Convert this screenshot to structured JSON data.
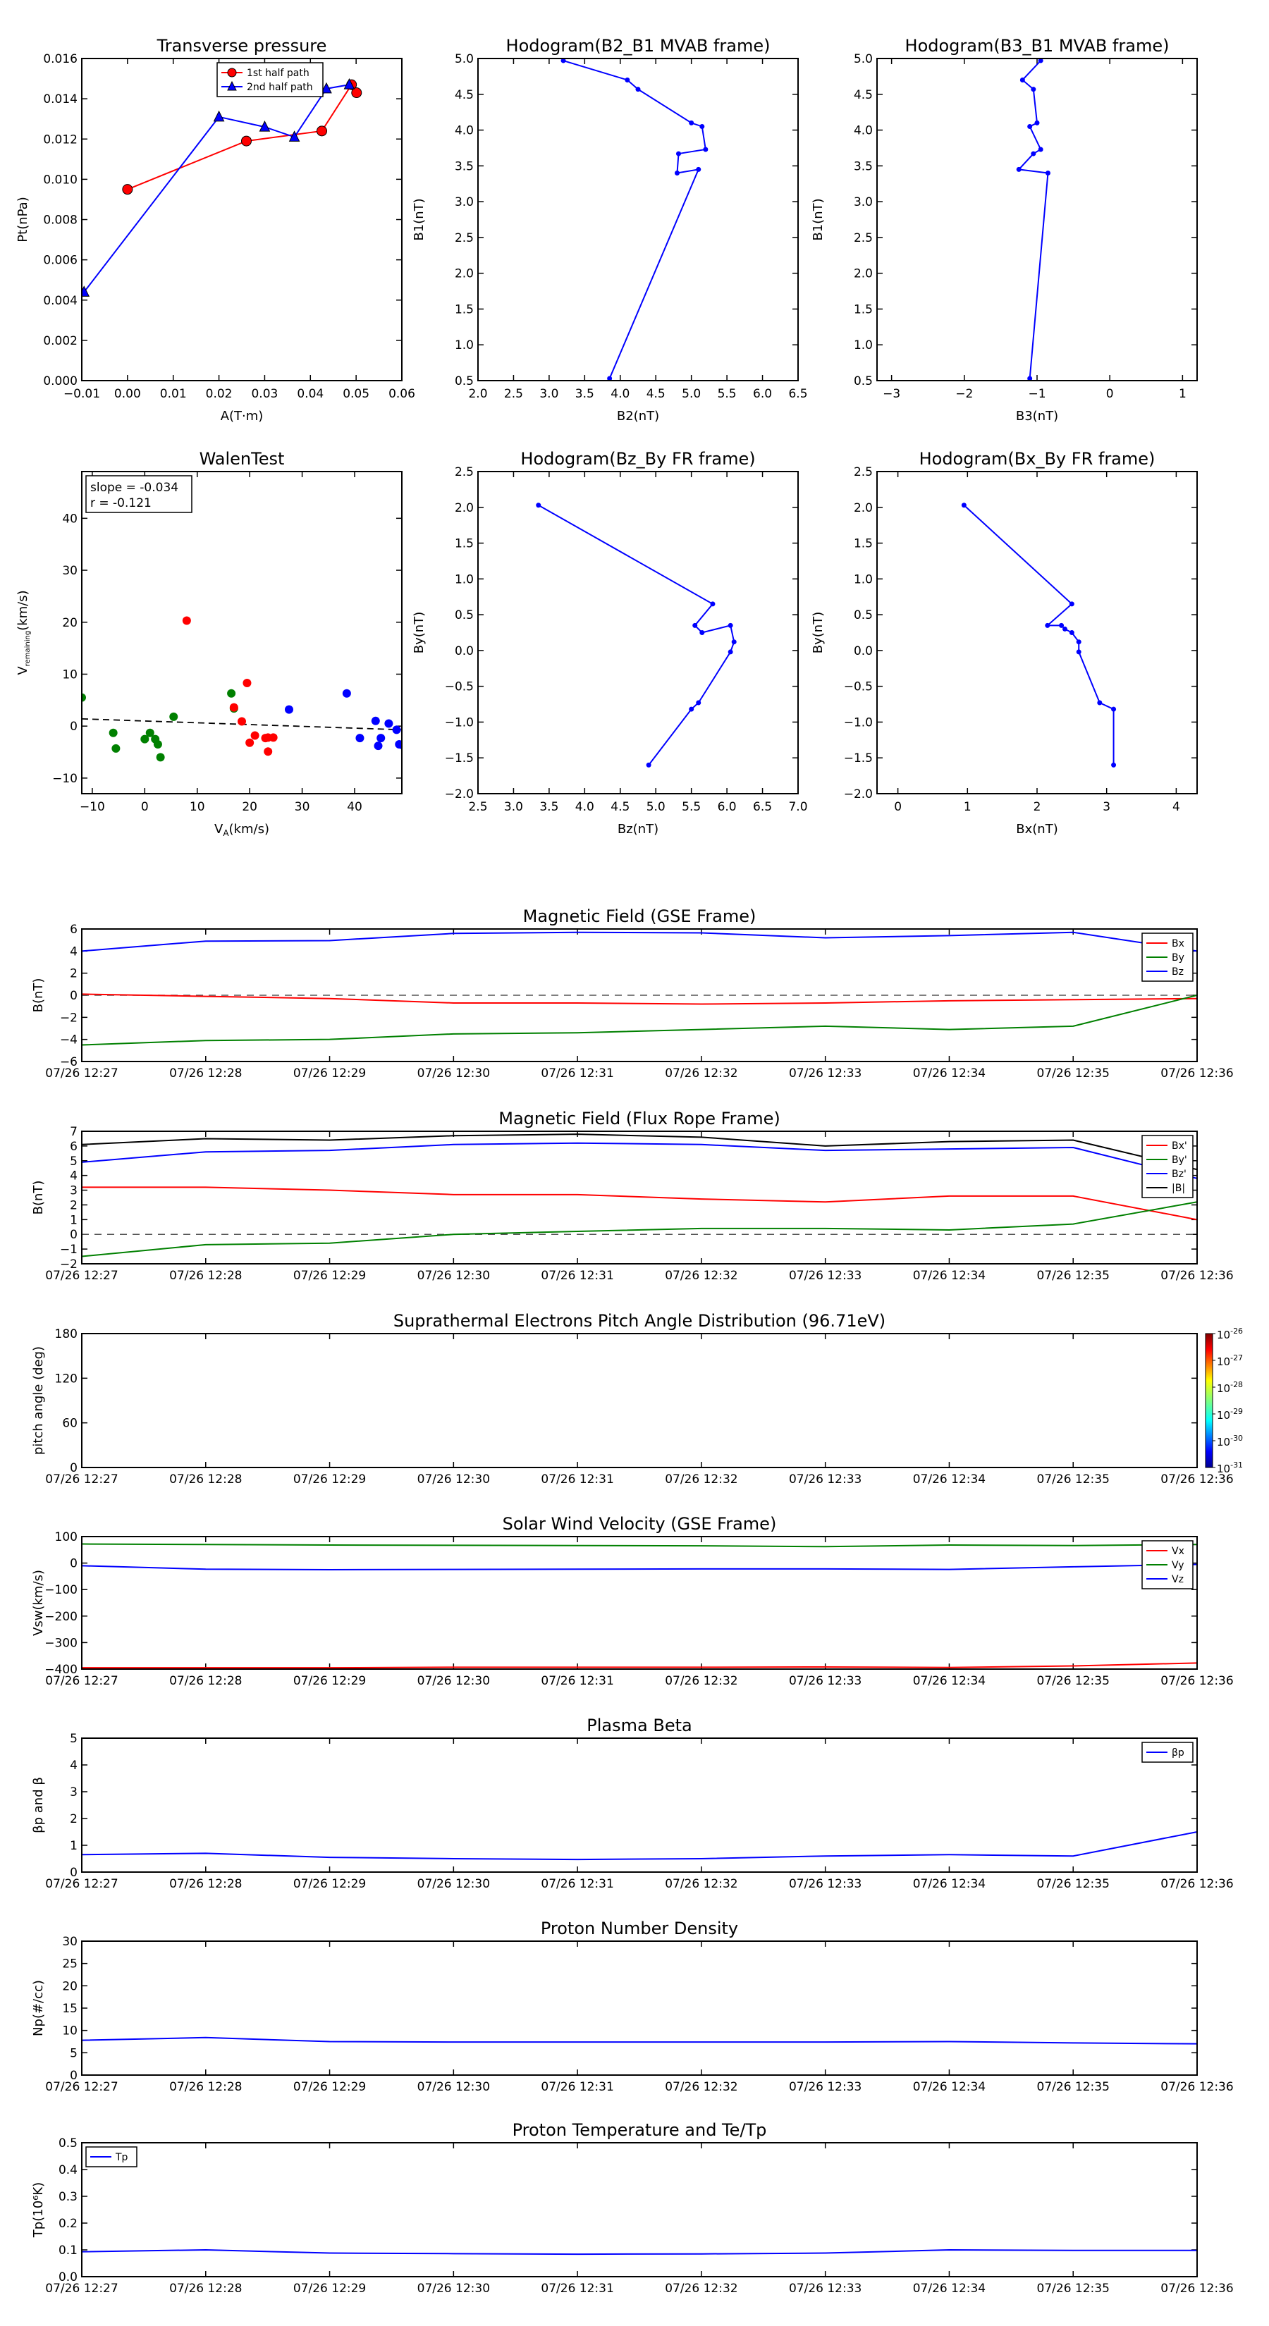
{
  "figure": {
    "time_ticks": [
      "07/26 12:27",
      "07/26 12:28",
      "07/26 12:29",
      "07/26 12:30",
      "07/26 12:31",
      "07/26 12:32",
      "07/26 12:33",
      "07/26 12:34",
      "07/26 12:35",
      "07/26 12:36"
    ]
  },
  "chart_data": [
    {
      "type": "line",
      "id": "tp",
      "title": "Transverse pressure",
      "xlabel": "A(T·m)",
      "ylabel": "Pt(nPa)",
      "xlim": [
        -0.01,
        0.06
      ],
      "ylim": [
        0,
        0.016
      ],
      "xticks": [
        -0.01,
        0.0,
        0.01,
        0.02,
        0.03,
        0.04,
        0.05,
        0.06
      ],
      "xticklabels": [
        "−0.01",
        "0.00",
        "0.01",
        "0.02",
        "0.03",
        "0.04",
        "0.05",
        "0.06"
      ],
      "yticks": [
        0,
        0.002,
        0.004,
        0.006,
        0.008,
        0.01,
        0.012,
        0.014,
        0.016
      ],
      "yticklabels": [
        "0.000",
        "0.002",
        "0.004",
        "0.006",
        "0.008",
        "0.010",
        "0.012",
        "0.014",
        "0.016"
      ],
      "legend": "top-center",
      "series": [
        {
          "name": "1st half path",
          "color": "#ff0000",
          "marker": "circle",
          "x": [
            0.0,
            0.026,
            0.0425,
            0.049,
            0.0501
          ],
          "y": [
            0.0095,
            0.0119,
            0.0124,
            0.0147,
            0.0143
          ]
        },
        {
          "name": "2nd half path",
          "color": "#0000ff",
          "marker": "triangle",
          "x": [
            -0.0095,
            0.02,
            0.03,
            0.0365,
            0.0435,
            0.0485
          ],
          "y": [
            0.0044,
            0.0131,
            0.0126,
            0.0121,
            0.0145,
            0.0147
          ]
        }
      ]
    },
    {
      "type": "line",
      "id": "h1",
      "title": "Hodogram(B2_B1 MVAB frame)",
      "xlabel": "B2(nT)",
      "ylabel": "B1(nT)",
      "xlim": [
        2.0,
        6.5
      ],
      "ylim": [
        0.5,
        5.0
      ],
      "xticks": [
        2.0,
        2.5,
        3.0,
        3.5,
        4.0,
        4.5,
        5.0,
        5.5,
        6.0,
        6.5
      ],
      "xticklabels": [
        "2.0",
        "2.5",
        "3.0",
        "3.5",
        "4.0",
        "4.5",
        "5.0",
        "5.5",
        "6.0",
        "6.5"
      ],
      "yticks": [
        0.5,
        1.0,
        1.5,
        2.0,
        2.5,
        3.0,
        3.5,
        4.0,
        4.5,
        5.0
      ],
      "yticklabels": [
        "0.5",
        "1.0",
        "1.5",
        "2.0",
        "2.5",
        "3.0",
        "3.5",
        "4.0",
        "4.5",
        "5.0"
      ],
      "series": [
        {
          "color": "#0000ff",
          "marker": "dot",
          "x": [
            3.2,
            4.1,
            4.25,
            5.0,
            5.15,
            5.2,
            4.82,
            4.8,
            5.1,
            3.85
          ],
          "y": [
            4.97,
            4.7,
            4.57,
            4.1,
            4.05,
            3.73,
            3.67,
            3.4,
            3.45,
            0.53
          ]
        }
      ]
    },
    {
      "type": "line",
      "id": "h2",
      "title": "Hodogram(B3_B1 MVAB frame)",
      "xlabel": "B3(nT)",
      "ylabel": "B1(nT)",
      "xlim": [
        -3.2,
        1.2
      ],
      "ylim": [
        0.5,
        5.0
      ],
      "xticks": [
        -3,
        -2,
        -1,
        0,
        1
      ],
      "xticklabels": [
        "−3",
        "−2",
        "−1",
        "0",
        "1"
      ],
      "yticks": [
        0.5,
        1.0,
        1.5,
        2.0,
        2.5,
        3.0,
        3.5,
        4.0,
        4.5,
        5.0
      ],
      "yticklabels": [
        "0.5",
        "1.0",
        "1.5",
        "2.0",
        "2.5",
        "3.0",
        "3.5",
        "4.0",
        "4.5",
        "5.0"
      ],
      "series": [
        {
          "color": "#0000ff",
          "marker": "dot",
          "x": [
            -0.95,
            -1.2,
            -1.05,
            -1.0,
            -1.1,
            -0.95,
            -1.05,
            -1.25,
            -0.85,
            -1.1
          ],
          "y": [
            4.97,
            4.7,
            4.57,
            4.1,
            4.05,
            3.73,
            3.67,
            3.45,
            3.4,
            0.53
          ]
        }
      ]
    },
    {
      "type": "scatter",
      "id": "walen",
      "title": "WalenTest",
      "xlabel": "V_A(km/s)",
      "ylabel": "V_remaining(km/s)",
      "xlim": [
        -12,
        49
      ],
      "ylim": [
        -13,
        49
      ],
      "xticks": [
        -10,
        0,
        10,
        20,
        30,
        40
      ],
      "xticklabels": [
        "−10",
        "0",
        "10",
        "20",
        "30",
        "40"
      ],
      "yticks": [
        -10,
        0,
        10,
        20,
        30,
        40
      ],
      "yticklabels": [
        "−10",
        "0",
        "10",
        "20",
        "30",
        "40"
      ],
      "annotation": [
        "slope = -0.034",
        "r = -0.121"
      ],
      "fit_line": {
        "x": [
          -12,
          49
        ],
        "y": [
          1.4,
          -0.7
        ]
      },
      "series": [
        {
          "color": "#008000",
          "x": [
            -12,
            -6,
            -5.5,
            0,
            1,
            2,
            2.5,
            3,
            5.5,
            16.5,
            17
          ],
          "y": [
            5.5,
            -1.3,
            -4.3,
            -2.5,
            -1.3,
            -2.5,
            -3.5,
            -6,
            1.8,
            6.3,
            3.4
          ]
        },
        {
          "color": "#ff0000",
          "x": [
            8,
            17,
            18.5,
            19.5,
            20,
            21,
            23,
            23.5,
            23.5,
            24.5
          ],
          "y": [
            20.3,
            3.6,
            0.9,
            8.3,
            -3.2,
            -1.8,
            -2.3,
            -2.2,
            -4.9,
            -2.2
          ]
        },
        {
          "color": "#0000ff",
          "x": [
            27.5,
            38.5,
            41,
            44,
            44.5,
            45,
            46.5,
            48,
            48.5,
            49
          ],
          "y": [
            3.2,
            6.3,
            -2.3,
            1.0,
            -3.8,
            -2.3,
            0.5,
            -0.7,
            -3.5,
            -3.6
          ]
        }
      ]
    },
    {
      "type": "line",
      "id": "h3",
      "title": "Hodogram(Bz_By FR frame)",
      "xlabel": "Bz(nT)",
      "ylabel": "By(nT)",
      "xlim": [
        2.5,
        7.0
      ],
      "ylim": [
        -2.0,
        2.5
      ],
      "xticks": [
        2.5,
        3.0,
        3.5,
        4.0,
        4.5,
        5.0,
        5.5,
        6.0,
        6.5,
        7.0
      ],
      "xticklabels": [
        "2.5",
        "3.0",
        "3.5",
        "4.0",
        "4.5",
        "5.0",
        "5.5",
        "6.0",
        "6.5",
        "7.0"
      ],
      "yticks": [
        -2.0,
        -1.5,
        -1.0,
        -0.5,
        0.0,
        0.5,
        1.0,
        1.5,
        2.0,
        2.5
      ],
      "yticklabels": [
        "−2.0",
        "−1.5",
        "−1.0",
        "−0.5",
        "0.0",
        "0.5",
        "1.0",
        "1.5",
        "2.0",
        "2.5"
      ],
      "series": [
        {
          "color": "#0000ff",
          "marker": "dot",
          "x": [
            3.35,
            5.8,
            5.55,
            5.65,
            6.05,
            6.1,
            6.05,
            5.6,
            5.5,
            4.9
          ],
          "y": [
            2.03,
            0.65,
            0.35,
            0.25,
            0.35,
            0.12,
            -0.02,
            -0.73,
            -0.82,
            -1.6
          ]
        }
      ]
    },
    {
      "type": "line",
      "id": "h4",
      "title": "Hodogram(Bx_By FR frame)",
      "xlabel": "Bx(nT)",
      "ylabel": "By(nT)",
      "xlim": [
        -0.3,
        4.3
      ],
      "ylim": [
        -2.0,
        2.5
      ],
      "xticks": [
        0,
        1,
        2,
        3,
        4
      ],
      "xticklabels": [
        "0",
        "1",
        "2",
        "3",
        "4"
      ],
      "yticks": [
        -2.0,
        -1.5,
        -1.0,
        -0.5,
        0.0,
        0.5,
        1.0,
        1.5,
        2.0,
        2.5
      ],
      "yticklabels": [
        "−2.0",
        "−1.5",
        "−1.0",
        "−0.5",
        "0.0",
        "0.5",
        "1.0",
        "1.5",
        "2.0",
        "2.5"
      ],
      "series": [
        {
          "color": "#0000ff",
          "marker": "dot",
          "x": [
            0.95,
            2.5,
            2.15,
            2.35,
            2.4,
            2.5,
            2.6,
            2.6,
            2.9,
            3.1,
            3.1
          ],
          "y": [
            2.03,
            0.65,
            0.35,
            0.35,
            0.3,
            0.25,
            0.12,
            -0.02,
            -0.73,
            -0.82,
            -1.6
          ]
        }
      ]
    },
    {
      "type": "line",
      "id": "mf_gse",
      "title": "Magnetic Field (GSE Frame)",
      "ylabel": "B(nT)",
      "xlim": [
        0,
        9
      ],
      "ylim": [
        -6,
        6
      ],
      "yticks": [
        -6,
        -4,
        -2,
        0,
        2,
        4,
        6
      ],
      "yticklabels": [
        "−6",
        "−4",
        "−2",
        "0",
        "2",
        "4",
        "6"
      ],
      "zero_line": true,
      "legend": "top-right",
      "series": [
        {
          "name": "Bx",
          "color": "#ff0000",
          "y": [
            0.1,
            -0.1,
            -0.3,
            -0.7,
            -0.7,
            -0.8,
            -0.7,
            -0.5,
            -0.4,
            -0.3
          ]
        },
        {
          "name": "By",
          "color": "#008000",
          "y": [
            -4.5,
            -4.1,
            -4.0,
            -3.5,
            -3.4,
            -3.1,
            -2.8,
            -3.1,
            -2.8,
            0.0
          ]
        },
        {
          "name": "Bz",
          "color": "#0000ff",
          "y": [
            4.0,
            4.9,
            4.95,
            5.6,
            5.7,
            5.65,
            5.2,
            5.4,
            5.7,
            4.0
          ]
        }
      ]
    },
    {
      "type": "line",
      "id": "mf_fr",
      "title": "Magnetic Field (Flux Rope Frame)",
      "ylabel": "B(nT)",
      "xlim": [
        0,
        9
      ],
      "ylim": [
        -2,
        7
      ],
      "yticks": [
        -2,
        -1,
        0,
        1,
        2,
        3,
        4,
        5,
        6,
        7
      ],
      "yticklabels": [
        "−2",
        "−1",
        "0",
        "1",
        "2",
        "3",
        "4",
        "5",
        "6",
        "7"
      ],
      "zero_line": true,
      "legend": "top-right",
      "series": [
        {
          "name": "Bx'",
          "color": "#ff0000",
          "y": [
            3.2,
            3.2,
            3.0,
            2.7,
            2.7,
            2.4,
            2.2,
            2.6,
            2.6,
            1.0
          ]
        },
        {
          "name": "By'",
          "color": "#008000",
          "y": [
            -1.5,
            -0.7,
            -0.6,
            0.0,
            0.2,
            0.4,
            0.4,
            0.3,
            0.7,
            2.2
          ]
        },
        {
          "name": "Bz'",
          "color": "#0000ff",
          "y": [
            4.9,
            5.6,
            5.7,
            6.1,
            6.2,
            6.1,
            5.7,
            5.8,
            5.9,
            3.8
          ]
        },
        {
          "name": "|B|",
          "color": "#000000",
          "y": [
            6.1,
            6.5,
            6.4,
            6.7,
            6.8,
            6.6,
            6.0,
            6.3,
            6.4,
            4.4
          ]
        }
      ]
    },
    {
      "type": "heatmap",
      "id": "pad",
      "title": "Suprathermal Electrons Pitch Angle Distribution (96.71eV)",
      "ylabel": "pitch angle (deg)",
      "xlim": [
        0,
        9
      ],
      "ylim": [
        0,
        180
      ],
      "yticks": [
        0,
        60,
        120,
        180
      ],
      "yticklabels": [
        "0",
        "60",
        "120",
        "180"
      ],
      "colorbar": {
        "labels": [
          "10",
          "10",
          "10",
          "10",
          "10",
          "10"
        ],
        "exponents": [
          "-26",
          "-27",
          "-28",
          "-29",
          "-30",
          "-31"
        ]
      }
    },
    {
      "type": "line",
      "id": "vsw",
      "title": "Solar Wind Velocity (GSE Frame)",
      "ylabel": "Vsw(km/s)",
      "xlim": [
        0,
        9
      ],
      "ylim": [
        -400,
        100
      ],
      "yticks": [
        -400,
        -300,
        -200,
        -100,
        0,
        100
      ],
      "yticklabels": [
        "−400",
        "−300",
        "−200",
        "−100",
        "0",
        "100"
      ],
      "legend": "top-right",
      "series": [
        {
          "name": "Vx",
          "color": "#ff0000",
          "y": [
            -395,
            -395,
            -395,
            -393,
            -393,
            -393,
            -392,
            -394,
            -388,
            -377
          ]
        },
        {
          "name": "Vy",
          "color": "#008000",
          "y": [
            72,
            70,
            68,
            67,
            66,
            65,
            62,
            68,
            66,
            70
          ]
        },
        {
          "name": "Vz",
          "color": "#0000ff",
          "y": [
            -10,
            -23,
            -25,
            -24,
            -23,
            -22,
            -22,
            -24,
            -14,
            -5
          ]
        }
      ]
    },
    {
      "type": "line",
      "id": "beta",
      "title": "Plasma Beta",
      "ylabel": "βp and β",
      "xlim": [
        0,
        9
      ],
      "ylim": [
        0,
        5
      ],
      "yticks": [
        0,
        1,
        2,
        3,
        4,
        5
      ],
      "yticklabels": [
        "0",
        "1",
        "2",
        "3",
        "4",
        "5"
      ],
      "legend": "top-right",
      "series": [
        {
          "name": "βp",
          "color": "#0000ff",
          "y": [
            0.65,
            0.7,
            0.55,
            0.5,
            0.47,
            0.5,
            0.6,
            0.65,
            0.6,
            1.5
          ]
        }
      ]
    },
    {
      "type": "line",
      "id": "np",
      "title": "Proton Number Density",
      "ylabel": "Np(#/cc)",
      "xlim": [
        0,
        9
      ],
      "ylim": [
        0,
        30
      ],
      "yticks": [
        0,
        5,
        10,
        15,
        20,
        25,
        30
      ],
      "yticklabels": [
        "0",
        "5",
        "10",
        "15",
        "20",
        "25",
        "30"
      ],
      "series": [
        {
          "color": "#0000ff",
          "y": [
            7.8,
            8.4,
            7.5,
            7.4,
            7.4,
            7.4,
            7.4,
            7.5,
            7.2,
            7.0
          ]
        }
      ]
    },
    {
      "type": "line",
      "id": "tpp",
      "title": "Proton Temperature and Te/Tp",
      "ylabel": "Tp(10⁶K)",
      "xlim": [
        0,
        9
      ],
      "ylim": [
        0,
        0.5
      ],
      "yticks": [
        0,
        0.1,
        0.2,
        0.3,
        0.4,
        0.5
      ],
      "yticklabels": [
        "0.0",
        "0.1",
        "0.2",
        "0.3",
        "0.4",
        "0.5"
      ],
      "legend": "top-left",
      "series": [
        {
          "name": "Tp",
          "color": "#0000ff",
          "y": [
            0.093,
            0.1,
            0.088,
            0.086,
            0.084,
            0.085,
            0.088,
            0.1,
            0.098,
            0.098
          ]
        }
      ]
    }
  ]
}
